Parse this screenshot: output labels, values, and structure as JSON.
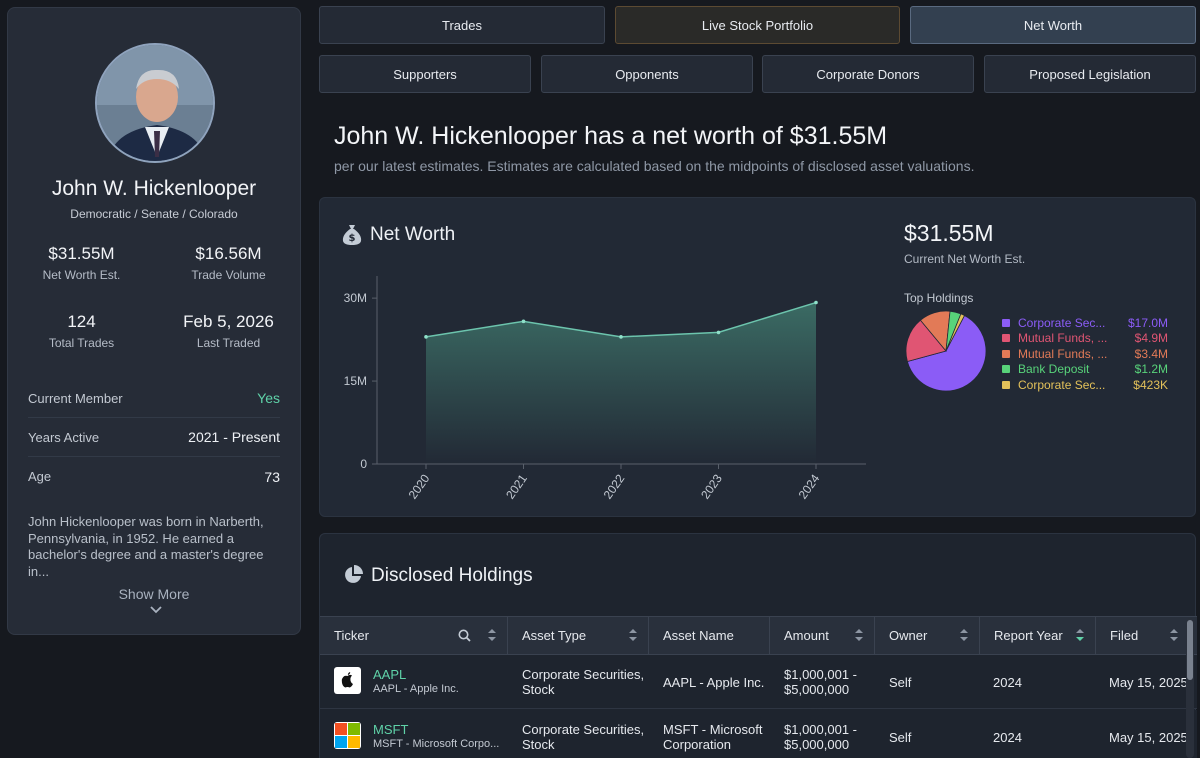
{
  "profile": {
    "name": "John W. Hickenlooper",
    "party": "Democratic / Senate / Colorado",
    "stats": {
      "net_worth": {
        "value": "$31.55M",
        "label": "Net Worth Est."
      },
      "trade_volume": {
        "value": "$16.56M",
        "label": "Trade Volume"
      },
      "total_trades": {
        "value": "124",
        "label": "Total Trades"
      },
      "last_traded": {
        "value": "Feb 5, 2026",
        "label": "Last Traded"
      }
    },
    "rows": [
      {
        "label": "Current Member",
        "value": "Yes"
      },
      {
        "label": "Years Active",
        "value": "2021 - Present"
      },
      {
        "label": "Age",
        "value": "73"
      }
    ],
    "bio": "John Hickenlooper was born in Narberth, Pennsylvania, in 1952. He earned a bachelor's degree and a master's degree in...",
    "show_more": "Show More"
  },
  "tabs": {
    "row1": [
      "Trades",
      "Live Stock Portfolio",
      "Net Worth"
    ],
    "row2": [
      "Supporters",
      "Opponents",
      "Corporate Donors",
      "Proposed Legislation"
    ],
    "active": "Net Worth"
  },
  "headline": "John W. Hickenlooper has a net worth of $31.55M",
  "subline": "per our latest estimates. Estimates are calculated based on the midpoints of disclosed asset valuations.",
  "net_worth_panel": {
    "title": "Net Worth",
    "current_value": "$31.55M",
    "current_label": "Current Net Worth Est.",
    "top_holdings_label": "Top Holdings"
  },
  "chart_data": [
    {
      "type": "area",
      "x": [
        "2020",
        "2021",
        "2022",
        "2023",
        "2024"
      ],
      "values": [
        23000000,
        25800000,
        23000000,
        23800000,
        29200000
      ],
      "yticks": [
        "0",
        "15M",
        "30M"
      ],
      "ylim": [
        0,
        34000000
      ],
      "grid": false,
      "color": "#4fa18a"
    },
    {
      "type": "pie",
      "categories": [
        "Corporate Sec...",
        "Mutual Funds, ...",
        "Mutual Funds, ...",
        "Bank Deposit",
        "Corporate Sec..."
      ],
      "values": [
        17.0,
        4.9,
        3.4,
        1.2,
        0.423
      ],
      "value_labels": [
        "$17.0M",
        "$4.9M",
        "$3.4M",
        "$1.2M",
        "$423K"
      ],
      "colors": [
        "#8b5cf6",
        "#e05573",
        "#e27a57",
        "#58d37a",
        "#e3c15a"
      ],
      "legend": "right"
    }
  ],
  "holdings": {
    "title": "Disclosed Holdings",
    "columns": [
      "Ticker",
      "Asset Type",
      "Asset Name",
      "Amount",
      "Owner",
      "Report Year",
      "Filed"
    ],
    "rows": [
      {
        "ticker": "AAPL",
        "ticker_sub": "AAPL - Apple Inc.",
        "asset_type": [
          "Corporate Securities,",
          "Stock"
        ],
        "asset_name": [
          "AAPL - Apple Inc."
        ],
        "amount": [
          "$1,000,001 -",
          "$5,000,000"
        ],
        "owner": "Self",
        "report_year": "2024",
        "filed": "May 15, 2025"
      },
      {
        "ticker": "MSFT",
        "ticker_sub": "MSFT - Microsoft Corpo...",
        "asset_type": [
          "Corporate Securities,",
          "Stock"
        ],
        "asset_name": [
          "MSFT - Microsoft",
          "Corporation"
        ],
        "amount": [
          "$1,000,001 -",
          "$5,000,000"
        ],
        "owner": "Self",
        "report_year": "2024",
        "filed": "May 15, 2025"
      }
    ]
  }
}
